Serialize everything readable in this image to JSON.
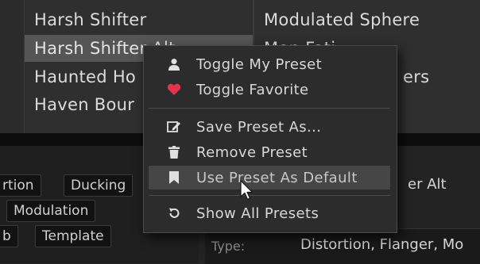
{
  "presets": {
    "left_column": [
      "Harsh Shifter",
      "Harsh Shifter Alt",
      "Haunted Ho",
      "Haven Bour"
    ],
    "selected_index": 1,
    "right_column": [
      "Modulated Sphere",
      "Mon Fati",
      "ers"
    ]
  },
  "tags": {
    "row1": [
      "rtion",
      "Ducking"
    ],
    "row2": [
      "Modulation"
    ],
    "row3": [
      "b",
      "Template"
    ]
  },
  "preview": {
    "name_fragment": "er Alt",
    "type_label": "Type:",
    "type_value": "Distortion, Flanger, Mo"
  },
  "context_menu": {
    "items": [
      {
        "label": "Toggle My Preset",
        "icon": "user-icon"
      },
      {
        "label": "Toggle Favorite",
        "icon": "heart-icon"
      },
      {
        "label": "Save Preset As...",
        "icon": "edit-icon"
      },
      {
        "label": "Remove Preset",
        "icon": "trash-icon"
      },
      {
        "label": "Use Preset As Default",
        "icon": "bookmark-icon"
      },
      {
        "label": "Show All Presets",
        "icon": "refresh-icon"
      }
    ],
    "highlighted_index": 4
  },
  "colors": {
    "favorite_heart": "#e0354d",
    "menu_background": "#2c2c2c",
    "highlight": "#464646"
  }
}
